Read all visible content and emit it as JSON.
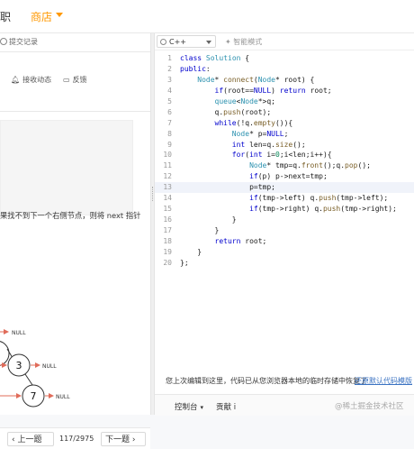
{
  "nav": {
    "job": "求职",
    "store": "商店"
  },
  "left": {
    "submit_records": "提交记录",
    "receive_updates": "接收动态",
    "feedback": "反馈",
    "description_snippet": "果找不到下一个右侧节点，则将 next 指针"
  },
  "tree": {
    "nodes": [
      "3",
      "7"
    ],
    "null_label": "NULL"
  },
  "pager": {
    "prev": "上一题",
    "count": "117/2975",
    "next": "下一题"
  },
  "editor": {
    "language": "C++",
    "smart_mode": "智能模式",
    "lines": [
      "class Solution {",
      "public:",
      "    Node* connect(Node* root) {",
      "        if(root==NULL) return root;",
      "        queue<Node*>q;",
      "        q.push(root);",
      "        while(!q.empty()){",
      "            Node* p=NULL;",
      "            int len=q.size();",
      "            for(int i=0;i<len;i++){",
      "                Node* tmp=q.front();q.pop();",
      "                if(p) p->next=tmp;",
      "                p=tmp;",
      "                if(tmp->left) q.push(tmp->left);",
      "                if(tmp->right) q.push(tmp->right);",
      "            }",
      "        }",
      "        return root;",
      "    }",
      "};"
    ],
    "current_line": 13,
    "restore_message": "您上次编辑到这里，代码已从您浏览器本地的临时存储中恢复了",
    "restore_link": "还原默认代码模版"
  },
  "bottom": {
    "console": "控制台",
    "contribute": "贡献 i",
    "watermark": "@稀土掘金技术社区"
  }
}
